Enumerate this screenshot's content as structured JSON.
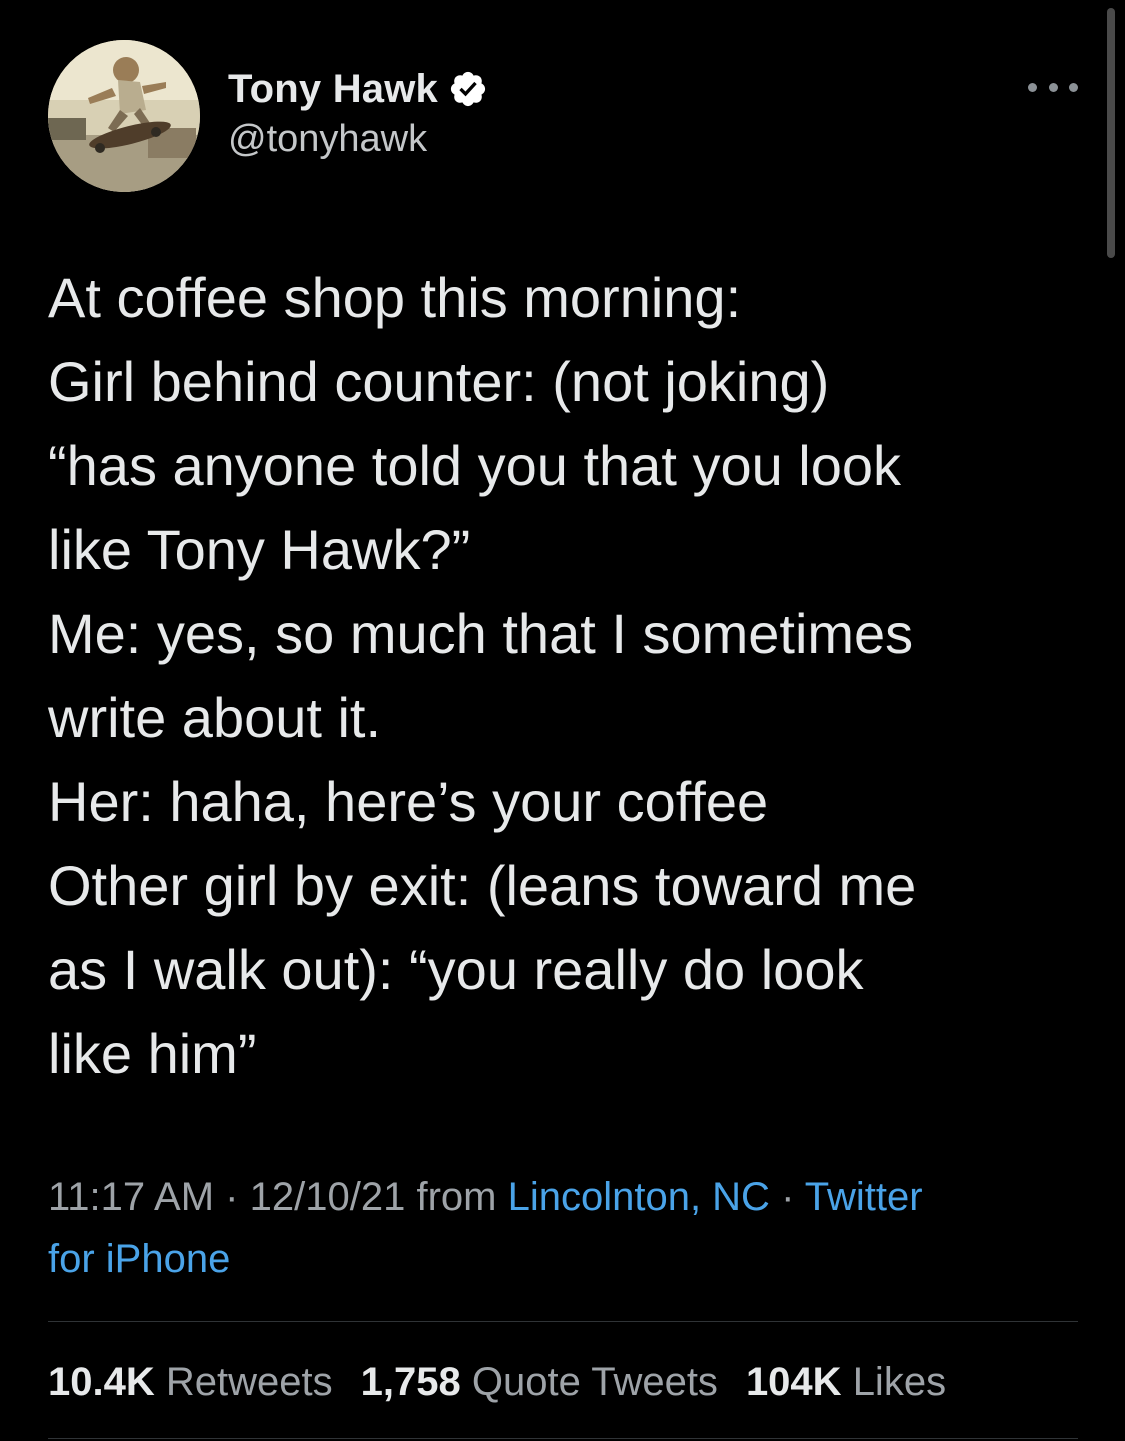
{
  "author": {
    "display_name": "Tony Hawk",
    "handle": "@tonyhawk",
    "verified_icon": "verified-badge-icon",
    "avatar_description_icon": "avatar"
  },
  "tweet": {
    "lines": [
      "At coffee shop this morning:",
      "Girl behind counter: (not joking)",
      "“has anyone told you that you look",
      "like Tony Hawk?”",
      "Me: yes, so much that I sometimes",
      "write about it.",
      "Her: haha, here’s your coffee",
      "Other girl by exit: (leans toward me",
      "as I walk out): “you really do look",
      "like him”"
    ],
    "time": "11:17 AM",
    "date": "12/10/21",
    "sep1": "·",
    "from_label": "from",
    "location": "Lincolnton, NC",
    "sep2": "·",
    "source_part1": "Twitter",
    "source_part2": "for iPhone"
  },
  "stats": {
    "retweets_count": "10.4K",
    "retweets_label": "Retweets",
    "quotes_count": "1,758",
    "quotes_label": "Quote Tweets",
    "likes_count": "104K",
    "likes_label": "Likes"
  },
  "colors": {
    "background": "#000000",
    "text": "#e7e9ea",
    "secondary": "#9ea3a8",
    "link": "#4aa3e8",
    "verified": "#ffffff"
  }
}
